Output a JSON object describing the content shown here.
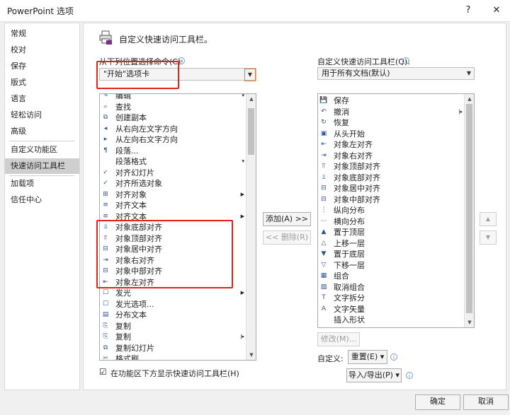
{
  "window": {
    "title": "PowerPoint 选项",
    "help": "?",
    "close": "✕"
  },
  "nav": {
    "items": [
      "常规",
      "校对",
      "保存",
      "版式",
      "语言",
      "轻松访问",
      "高级",
      "自定义功能区",
      "快速访问工具栏",
      "加载项",
      "信任中心"
    ],
    "active": "快速访问工具栏"
  },
  "header": {
    "title": "自定义快速访问工具栏。"
  },
  "left": {
    "label": "从下列位置选择命令(C):",
    "info": "i",
    "dropdown_value": "\"开始\"选项卡",
    "dropdown_arrow": "▼",
    "commands": [
      {
        "icon": "✎",
        "name": "edit-icon",
        "text": "编辑",
        "arrow": "▾"
      },
      {
        "icon": "⌕",
        "name": "find-icon",
        "text": "查找",
        "arrow": ""
      },
      {
        "icon": "⧉",
        "name": "duplicate-icon",
        "text": "创建副本",
        "arrow": ""
      },
      {
        "icon": "◂",
        "name": "rtl-icon",
        "text": "从右向左文字方向",
        "arrow": ""
      },
      {
        "icon": "▸",
        "name": "ltr-icon",
        "text": "从左向右文字方向",
        "arrow": ""
      },
      {
        "icon": "¶",
        "name": "paragraph-icon",
        "text": "段落...",
        "arrow": ""
      },
      {
        "icon": "",
        "name": "",
        "text": "段落格式",
        "arrow": "▾"
      },
      {
        "icon": "✓",
        "name": "check-icon",
        "text": "对齐幻灯片",
        "arrow": ""
      },
      {
        "icon": "✓",
        "name": "check-icon",
        "text": "对齐所选对象",
        "arrow": ""
      },
      {
        "icon": "⊞",
        "name": "align-objects-icon",
        "text": "对齐对象",
        "arrow": "▶"
      },
      {
        "icon": "≡",
        "name": "align-text-icon",
        "text": "对齐文本",
        "arrow": ""
      },
      {
        "icon": "≡",
        "name": "align-text-icon",
        "text": "对齐文本",
        "arrow": "▶"
      },
      {
        "icon": "⫫",
        "name": "align-bottom-icon",
        "text": "对象底部对齐",
        "arrow": ""
      },
      {
        "icon": "⫪",
        "name": "align-top-icon",
        "text": "对象顶部对齐",
        "arrow": ""
      },
      {
        "icon": "⊟",
        "name": "align-center-icon",
        "text": "对象居中对齐",
        "arrow": ""
      },
      {
        "icon": "⇥",
        "name": "align-right-icon",
        "text": "对象右对齐",
        "arrow": ""
      },
      {
        "icon": "⊟",
        "name": "align-middle-icon",
        "text": "对象中部对齐",
        "arrow": ""
      },
      {
        "icon": "⇤",
        "name": "align-left-icon",
        "text": "对象左对齐",
        "arrow": ""
      },
      {
        "icon": "☐",
        "name": "glow-icon",
        "text": "发光",
        "arrow": "▶"
      },
      {
        "icon": "☐",
        "name": "glow-options-icon",
        "text": "发光选项...",
        "arrow": ""
      },
      {
        "icon": "▤",
        "name": "distribute-text-icon",
        "text": "分布文本",
        "arrow": ""
      },
      {
        "icon": "⎘",
        "name": "copy-icon",
        "text": "复制",
        "arrow": ""
      },
      {
        "icon": "⎘",
        "name": "copy-icon",
        "text": "复制",
        "arrow": "|▸"
      },
      {
        "icon": "⧉",
        "name": "duplicate-slide-icon",
        "text": "复制幻灯片",
        "arrow": ""
      },
      {
        "icon": "✂",
        "name": "format-painter-icon",
        "text": "格式刷",
        "arrow": ""
      }
    ]
  },
  "middle": {
    "add_label": "添加(A) >>",
    "remove_label": "<< 删除(R)"
  },
  "right": {
    "label": "自定义快速访问工具栏(Q):",
    "info": "i",
    "dropdown_value": "用于所有文档(默认)",
    "dropdown_arrow": "▼",
    "commands": [
      {
        "icon": "💾",
        "name": "save-icon",
        "text": "保存",
        "arrow": ""
      },
      {
        "icon": "↶",
        "name": "undo-icon",
        "text": "撤消",
        "arrow": "|▸"
      },
      {
        "icon": "↻",
        "name": "redo-icon",
        "text": "恢复",
        "arrow": ""
      },
      {
        "icon": "▣",
        "name": "from-start-icon",
        "text": "从头开始",
        "arrow": ""
      },
      {
        "icon": "⇤",
        "name": "align-left-icon",
        "text": "对象左对齐",
        "arrow": ""
      },
      {
        "icon": "⇥",
        "name": "align-right-icon",
        "text": "对象右对齐",
        "arrow": ""
      },
      {
        "icon": "⫪",
        "name": "align-top-icon",
        "text": "对象顶部对齐",
        "arrow": ""
      },
      {
        "icon": "⫫",
        "name": "align-bottom-icon",
        "text": "对象底部对齐",
        "arrow": ""
      },
      {
        "icon": "⊟",
        "name": "align-center-icon",
        "text": "对象居中对齐",
        "arrow": ""
      },
      {
        "icon": "⊟",
        "name": "align-middle-icon",
        "text": "对象中部对齐",
        "arrow": ""
      },
      {
        "icon": "⋮",
        "name": "distribute-vertical-icon",
        "text": "纵向分布",
        "arrow": ""
      },
      {
        "icon": "⋯",
        "name": "distribute-horizontal-icon",
        "text": "横向分布",
        "arrow": ""
      },
      {
        "icon": "▲",
        "name": "bring-front-icon",
        "text": "置于顶层",
        "arrow": ""
      },
      {
        "icon": "△",
        "name": "bring-forward-icon",
        "text": "上移一层",
        "arrow": ""
      },
      {
        "icon": "▼",
        "name": "send-back-icon",
        "text": "置于底层",
        "arrow": ""
      },
      {
        "icon": "▽",
        "name": "send-backward-icon",
        "text": "下移一层",
        "arrow": ""
      },
      {
        "icon": "▦",
        "name": "group-icon",
        "text": "组合",
        "arrow": ""
      },
      {
        "icon": "▧",
        "name": "ungroup-icon",
        "text": "取消组合",
        "arrow": ""
      },
      {
        "icon": "T",
        "name": "split-text-icon",
        "text": "文字拆分",
        "arrow": ""
      },
      {
        "icon": "A",
        "name": "text-vector-icon",
        "text": "文字矢量",
        "arrow": ""
      },
      {
        "icon": "",
        "name": "",
        "text": "插入形状",
        "arrow": ""
      }
    ],
    "modify_label": "修改(M)...",
    "customize_label": "自定义:",
    "reset_label": "重置(E) ▾",
    "import_export_label": "导入/导出(P) ▾",
    "move_up": "▲",
    "move_down": "▼"
  },
  "checkbox": {
    "checked": "☑",
    "label": "在功能区下方显示快速访问工具栏(H)"
  },
  "footer": {
    "ok": "确定",
    "cancel": "取消"
  }
}
